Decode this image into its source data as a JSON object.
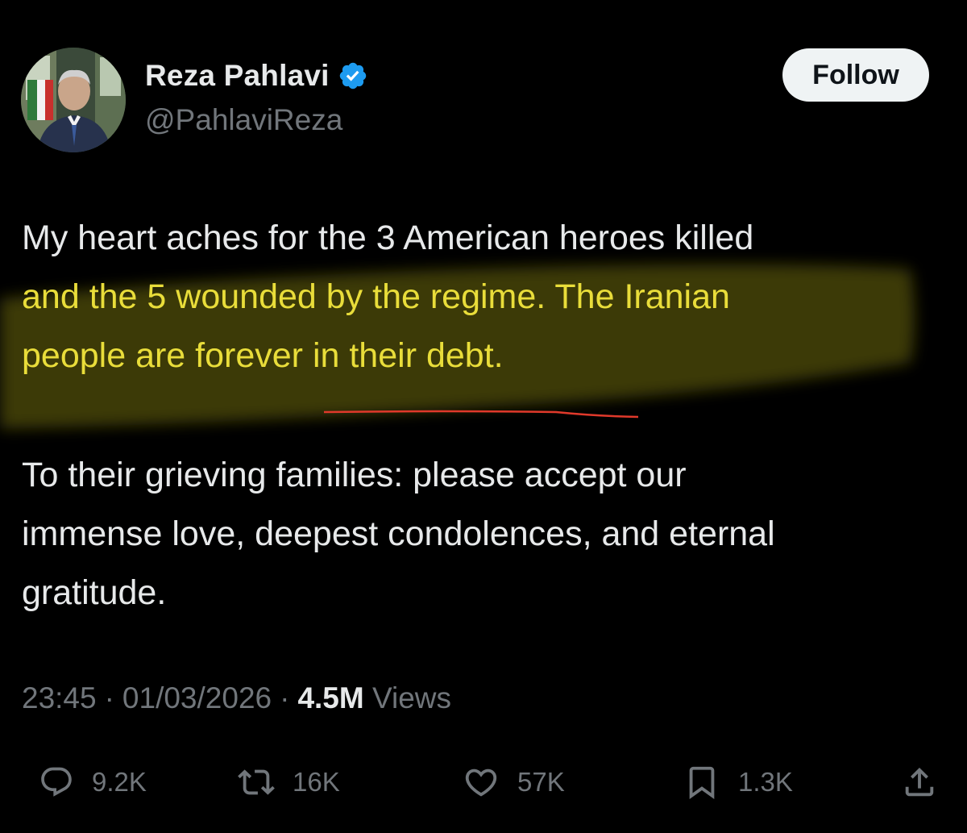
{
  "author": {
    "display_name": "Reza Pahlavi",
    "handle": "@PahlaviReza",
    "verified": true
  },
  "follow_button": {
    "label": "Follow"
  },
  "tweet": {
    "paragraph1": {
      "line1": "My heart aches for the 3 American heroes killed",
      "line2": "and the 5 wounded by the regime. The Iranian",
      "line3": "people are forever in their debt."
    },
    "paragraph2": {
      "line1": "To their grieving families: please accept our",
      "line2": "immense love, deepest condolences, and eternal",
      "line3": "gratitude."
    }
  },
  "meta": {
    "time": "23:45",
    "separator": "·",
    "date": "01/03/2026",
    "views_count": "4.5M",
    "views_label": "Views"
  },
  "actions": {
    "replies": "9.2K",
    "reposts": "16K",
    "likes": "57K",
    "bookmarks": "1.3K"
  },
  "colors": {
    "background": "#000000",
    "text": "#e7e9ea",
    "secondary": "#71767b",
    "verified_blue": "#1d9bf0",
    "highlight_yellow": "#e9dd3a",
    "underline_red": "#e0392b"
  },
  "icons": {
    "verified": "verified-badge-icon",
    "reply": "reply-icon",
    "repost": "repost-icon",
    "like": "heart-icon",
    "bookmark": "bookmark-icon",
    "share": "share-icon"
  }
}
